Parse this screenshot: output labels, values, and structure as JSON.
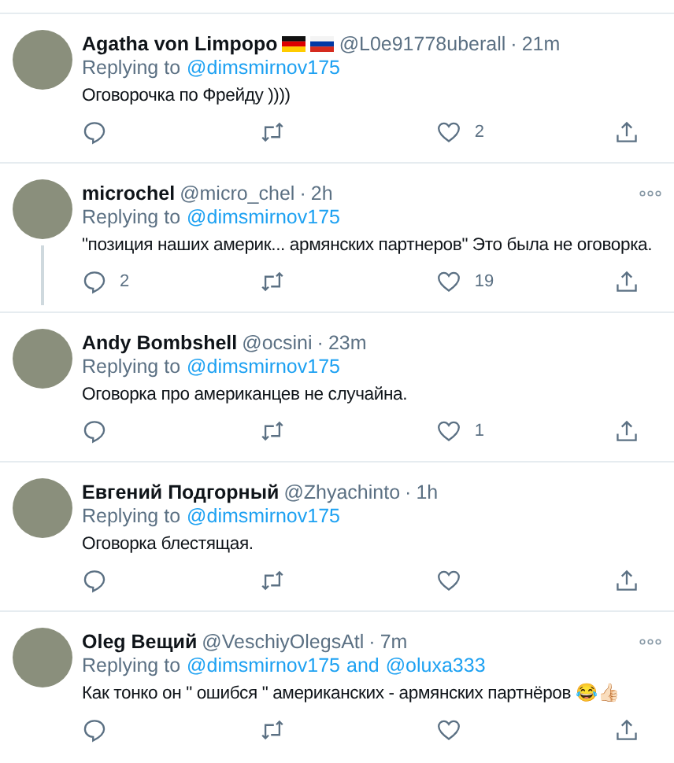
{
  "tweets": [
    {
      "name": "Agatha von Limpopo",
      "badges": [
        {
          "kind": "flag-de"
        },
        {
          "kind": "flag-ru"
        }
      ],
      "handle": "@L0e91778uberall",
      "separator": "·",
      "time": "21m",
      "more": false,
      "thread_line": false,
      "replying": [
        {
          "kind": "plain",
          "text": "Replying to"
        },
        {
          "kind": "link",
          "text": "@dimsmirnov175"
        }
      ],
      "text": "Оговорочка по Фрейду ))))",
      "actions": [
        {
          "kind": "reply"
        },
        {
          "kind": "retweet"
        },
        {
          "kind": "like",
          "count": "2"
        },
        {
          "kind": "share"
        }
      ]
    },
    {
      "name": "microchel",
      "handle": "@micro_chel",
      "separator": "·",
      "time": "2h",
      "more": true,
      "thread_line": true,
      "replying": [
        {
          "kind": "plain",
          "text": "Replying to"
        },
        {
          "kind": "link",
          "text": "@dimsmirnov175"
        }
      ],
      "text": "\"позиция наших америк... армянских партнеров\" Это была не оговорка.",
      "actions": [
        {
          "kind": "reply",
          "count": "2"
        },
        {
          "kind": "retweet"
        },
        {
          "kind": "like",
          "count": "19"
        },
        {
          "kind": "share"
        }
      ]
    },
    {
      "name": "Andy Bombshell",
      "handle": "@ocsini",
      "separator": "·",
      "time": "23m",
      "more": false,
      "thread_line": false,
      "replying": [
        {
          "kind": "plain",
          "text": "Replying to"
        },
        {
          "kind": "link",
          "text": "@dimsmirnov175"
        }
      ],
      "text": "Оговорка про американцев не случайна.",
      "actions": [
        {
          "kind": "reply"
        },
        {
          "kind": "retweet"
        },
        {
          "kind": "like",
          "count": "1"
        },
        {
          "kind": "share"
        }
      ]
    },
    {
      "name": "Евгений Подгорный",
      "handle": "@Zhyachinto",
      "separator": "·",
      "time": "1h",
      "more": false,
      "thread_line": false,
      "replying": [
        {
          "kind": "plain",
          "text": "Replying to"
        },
        {
          "kind": "link",
          "text": "@dimsmirnov175"
        }
      ],
      "text": "Оговорка блестящая.",
      "actions": [
        {
          "kind": "reply"
        },
        {
          "kind": "retweet"
        },
        {
          "kind": "like"
        },
        {
          "kind": "share"
        }
      ]
    },
    {
      "name": "Oleg Вещий",
      "handle": "@VeschiyOlegsAtl",
      "separator": "·",
      "time": "7m",
      "more": true,
      "thread_line": false,
      "replying": [
        {
          "kind": "plain",
          "text": "Replying to"
        },
        {
          "kind": "link",
          "text": "@dimsmirnov175"
        },
        {
          "kind": "link",
          "text": "and"
        },
        {
          "kind": "link",
          "text": "@oluxa333"
        }
      ],
      "text": "Как тонко он \" ошибся \" американских - армянских партнёров 😂👍🏻",
      "actions": [
        {
          "kind": "reply"
        },
        {
          "kind": "retweet"
        },
        {
          "kind": "like"
        },
        {
          "kind": "share"
        }
      ]
    }
  ]
}
